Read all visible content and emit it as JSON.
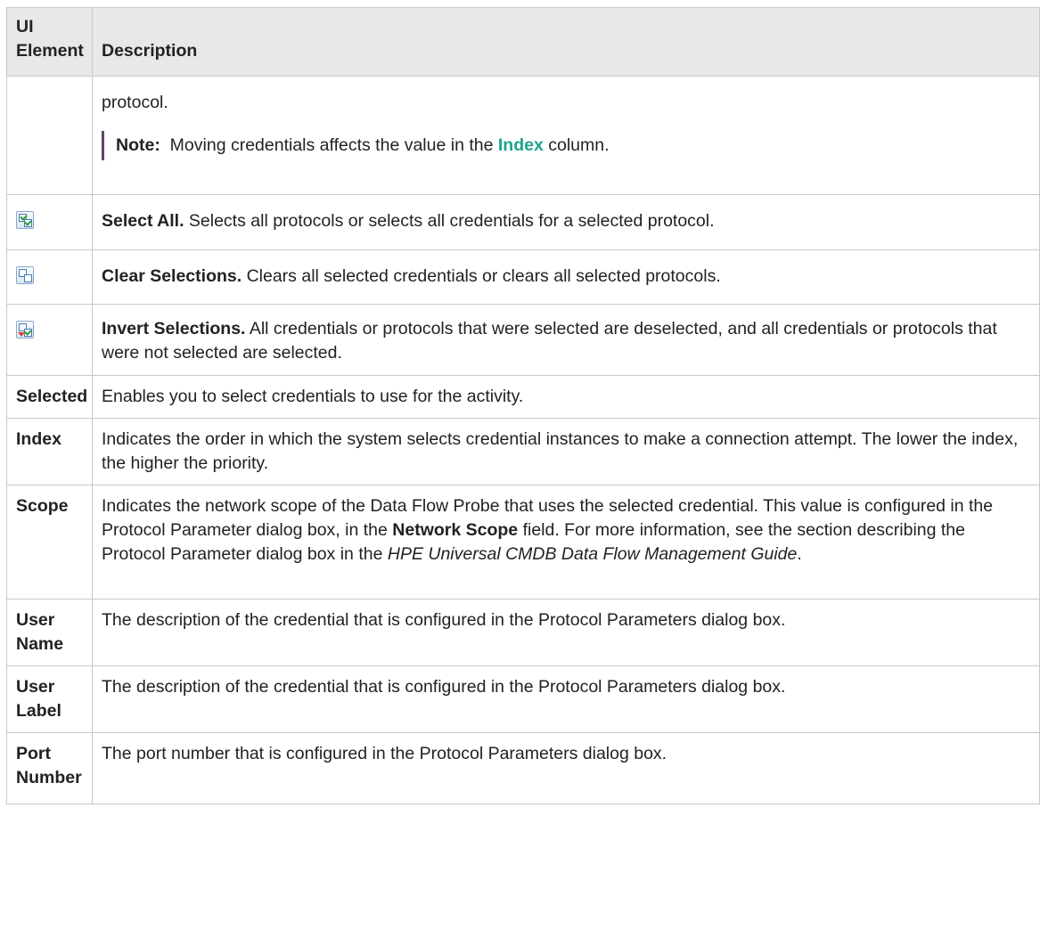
{
  "header": {
    "col_element": "UI Element",
    "col_description": "Description"
  },
  "rows": [
    {
      "element": "",
      "description": "protocol.",
      "note": {
        "label": "Note:",
        "text_before": "Moving credentials affects the value in the",
        "link": "Index",
        "text_after": "column."
      }
    },
    {
      "element_icon": "select-all-icon",
      "title": "Select All.",
      "description": "Selects all protocols or selects all credentials for a selected protocol."
    },
    {
      "element_icon": "clear-selections-icon",
      "title": "Clear Selections.",
      "description": "Clears all selected credentials or clears all selected protocols."
    },
    {
      "element_icon": "invert-selections-icon",
      "title": "Invert Selections.",
      "description": "All credentials or protocols that were selected are deselected, and all credentials or protocols that were not selected are selected."
    },
    {
      "element": "Selected",
      "description": "Enables you to select credentials to use for the activity."
    },
    {
      "element": "Index",
      "description": "Indicates the order in which the system selects credential instances to make a connection attempt. The lower the index, the higher the priority."
    },
    {
      "element": "Scope",
      "description_part1": "Indicates the network scope of the Data Flow Probe that uses the selected credential. This value is configured in the Protocol Parameter dialog box, in the",
      "bold_field": "Network Scope",
      "description_part2": "field. For more information, see the section describing the Protocol Parameter dialog box in the",
      "guide": "HPE Universal CMDB Data Flow Management Guide",
      "description_end": "."
    },
    {
      "element": "User Name",
      "description": "The description of the credential that is configured in the Protocol Parameters dialog box."
    },
    {
      "element": "User Label",
      "description": "The description of the credential that is configured in the Protocol Parameters dialog box."
    },
    {
      "element": "Port Number",
      "description": "The port number that is configured in the Protocol Parameters dialog box."
    }
  ]
}
